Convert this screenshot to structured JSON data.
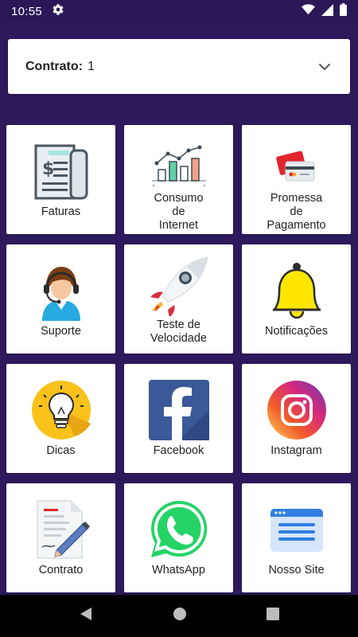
{
  "status_bar": {
    "time": "10:55",
    "icons": [
      "gear-icon",
      "wifi-icon",
      "signal-icon",
      "battery-icon"
    ]
  },
  "contract": {
    "label": "Contrato:",
    "value": "1",
    "icon": "chevron-down-icon"
  },
  "tiles": [
    {
      "label": "Faturas",
      "icon": "invoice-icon"
    },
    {
      "label": "Consumo\nde\nInternet",
      "icon": "bar-chart-icon"
    },
    {
      "label": "Promessa\nde\nPagamento",
      "icon": "credit-card-icon"
    },
    {
      "label": "Suporte",
      "icon": "support-agent-icon"
    },
    {
      "label": "Teste de\nVelocidade",
      "icon": "rocket-icon"
    },
    {
      "label": "Notificações",
      "icon": "bell-icon"
    },
    {
      "label": "Dicas",
      "icon": "lightbulb-icon"
    },
    {
      "label": "Facebook",
      "icon": "facebook-icon"
    },
    {
      "label": "Instagram",
      "icon": "instagram-icon"
    },
    {
      "label": "Contrato",
      "icon": "contract-document-icon"
    },
    {
      "label": "WhatsApp",
      "icon": "whatsapp-icon"
    },
    {
      "label": "Nosso Site",
      "icon": "website-icon"
    }
  ],
  "nav": [
    "back-icon",
    "home-icon",
    "recents-icon"
  ],
  "colors": {
    "background": "#2d1a5c",
    "status_bar": "#2a1858",
    "tile": "#ffffff",
    "facebook": "#3b5998",
    "whatsapp": "#25d366",
    "bell": "#ffe600"
  }
}
